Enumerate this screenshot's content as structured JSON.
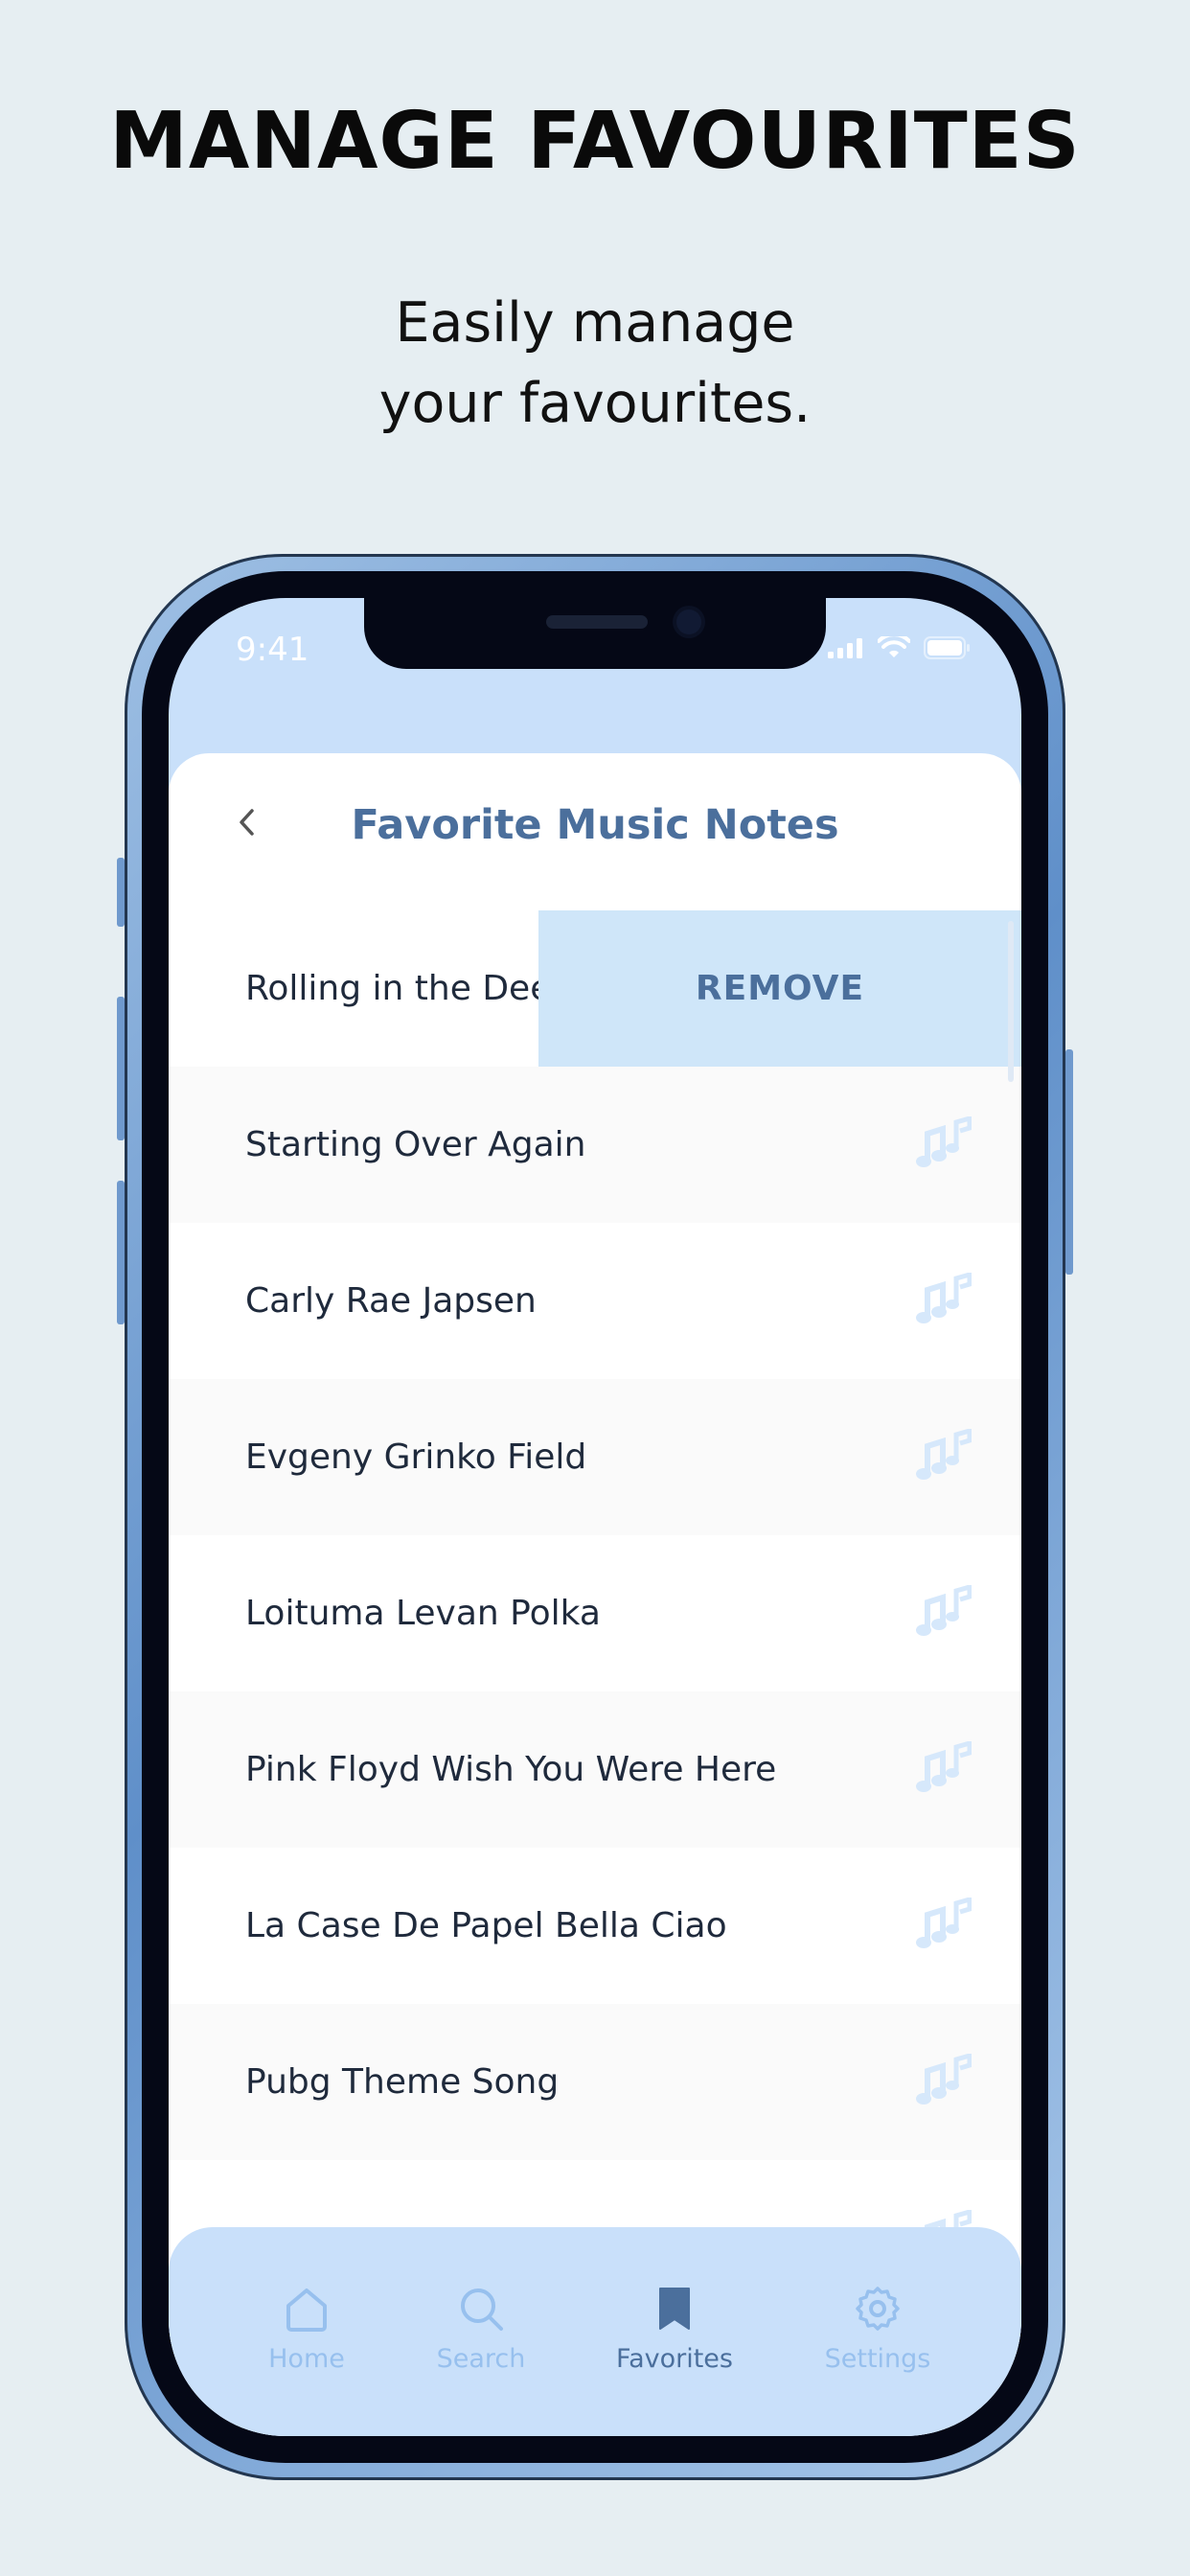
{
  "promo": {
    "headline": "MANAGE FAVOURITES",
    "subline_1": "Easily manage",
    "subline_2": "your favourites."
  },
  "status_bar": {
    "time": "9:41",
    "icons": [
      "signal-icon",
      "wifi-icon",
      "battery-icon"
    ]
  },
  "header": {
    "title": "Favorite Music Notes",
    "back_icon": "chevron-left-icon"
  },
  "songs": [
    "Rolling in the Deep",
    "Starting Over Again",
    "Carly Rae Japsen",
    "Evgeny Grinko Field",
    "Loituma Levan Polka",
    "Pink Floyd Wish You Were Here",
    "La Case De Papel Bella Ciao",
    "Pubg Theme Song"
  ],
  "swipe_action": {
    "label": "REMOVE",
    "row_index": 0
  },
  "row_icon": "music-notes-icon",
  "tabbar": {
    "items": [
      {
        "label": "Home",
        "icon": "home-icon",
        "active": false
      },
      {
        "label": "Search",
        "icon": "search-icon",
        "active": false
      },
      {
        "label": "Favorites",
        "icon": "bookmark-icon",
        "active": true
      },
      {
        "label": "Settings",
        "icon": "gear-icon",
        "active": false
      }
    ]
  },
  "colors": {
    "background": "#e6eef2",
    "screen_tint": "#c9e0fa",
    "accent": "#4b6f9c",
    "inactive_tab": "#97c0ee",
    "remove_bg": "#cfe6f9"
  }
}
